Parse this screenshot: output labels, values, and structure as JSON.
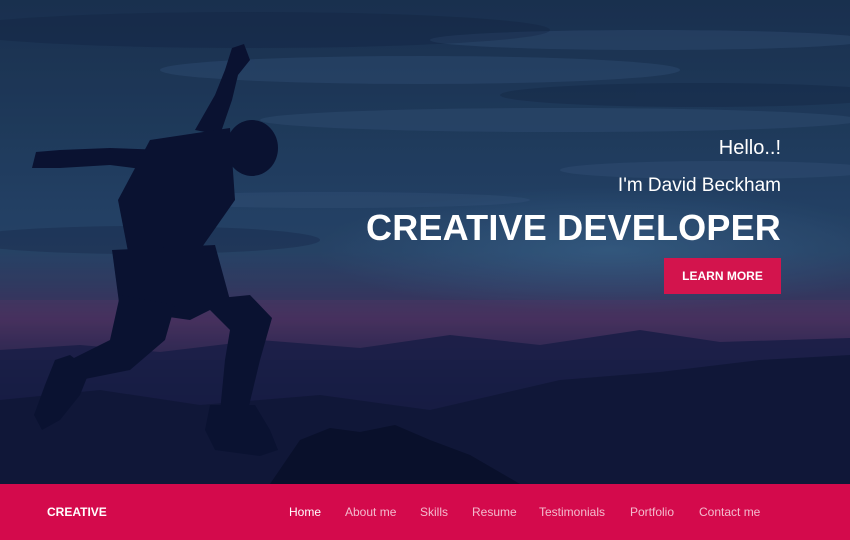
{
  "hero": {
    "greeting": "Hello..!",
    "name_line": "I'm David Beckham",
    "headline": "CREATIVE DEVELOPER",
    "cta_label": "LEARN MORE"
  },
  "navbar": {
    "brand": "CREATIVE",
    "links": [
      {
        "label": "Home",
        "active": true
      },
      {
        "label": "About me",
        "active": false
      },
      {
        "label": "Skills",
        "active": false
      },
      {
        "label": "Resume",
        "active": false
      },
      {
        "label": "Testimonials",
        "active": false
      },
      {
        "label": "Portfolio",
        "active": false
      },
      {
        "label": "Contact me",
        "active": false
      }
    ]
  },
  "colors": {
    "accent": "#d40a4c",
    "button": "#d3144d",
    "hero_dark": "#0b1230",
    "text": "#ffffff"
  }
}
